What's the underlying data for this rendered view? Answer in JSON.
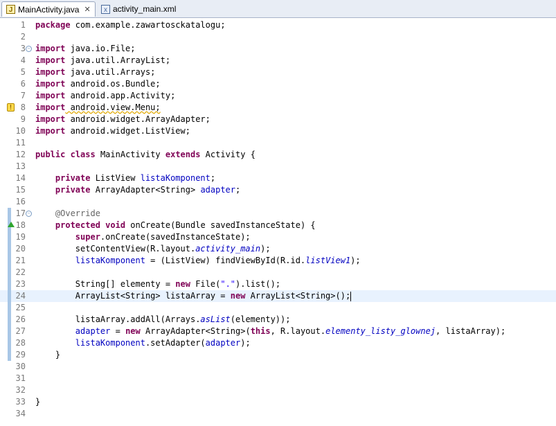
{
  "tabs": [
    {
      "label": "MainActivity.java",
      "icon": "java-file-icon",
      "active": true,
      "close": "✕"
    },
    {
      "label": "activity_main.xml",
      "icon": "xml-file-icon",
      "active": false
    }
  ],
  "current_line": 24,
  "lines": [
    {
      "n": "1",
      "t": [
        [
          "kw",
          "package"
        ],
        [
          "",
          "com.example.zawartosckatalogu;"
        ]
      ]
    },
    {
      "n": "2",
      "t": []
    },
    {
      "n": "3",
      "fold": "−",
      "t": [
        [
          "kw",
          "import"
        ],
        [
          "",
          "java.io.File;"
        ]
      ]
    },
    {
      "n": "4",
      "t": [
        [
          "kw",
          "import"
        ],
        [
          "",
          "java.util.ArrayList;"
        ]
      ]
    },
    {
      "n": "5",
      "t": [
        [
          "kw",
          "import"
        ],
        [
          "",
          "java.util.Arrays;"
        ]
      ]
    },
    {
      "n": "6",
      "t": [
        [
          "kw",
          "import"
        ],
        [
          "",
          "android.os.Bundle;"
        ]
      ]
    },
    {
      "n": "7",
      "t": [
        [
          "kw",
          "import"
        ],
        [
          "",
          "android.app.Activity;"
        ]
      ]
    },
    {
      "n": "8",
      "marker": "warning",
      "t": [
        [
          "kw",
          "import"
        ],
        [
          "",
          "android.view.Menu;",
          "warn"
        ]
      ]
    },
    {
      "n": "9",
      "t": [
        [
          "kw",
          "import"
        ],
        [
          "",
          "android.widget.ArrayAdapter;"
        ]
      ]
    },
    {
      "n": "10",
      "t": [
        [
          "kw",
          "import"
        ],
        [
          "",
          "android.widget.ListView;"
        ]
      ]
    },
    {
      "n": "11",
      "t": []
    },
    {
      "n": "12",
      "t": [
        [
          "kw",
          "public"
        ],
        [
          "",
          " "
        ],
        [
          "kw",
          "class"
        ],
        [
          "",
          " MainActivity "
        ],
        [
          "kw",
          "extends"
        ],
        [
          "",
          " Activity {"
        ]
      ]
    },
    {
      "n": "13",
      "t": []
    },
    {
      "n": "14",
      "t": [
        [
          "",
          "    "
        ],
        [
          "kw",
          "private"
        ],
        [
          "",
          " ListView "
        ],
        [
          "fld",
          "listaKomponent"
        ],
        [
          "",
          ";"
        ]
      ]
    },
    {
      "n": "15",
      "t": [
        [
          "",
          "    "
        ],
        [
          "kw",
          "private"
        ],
        [
          "",
          " ArrayAdapter<String> "
        ],
        [
          "fld",
          "adapter"
        ],
        [
          "",
          ";"
        ]
      ]
    },
    {
      "n": "16",
      "t": []
    },
    {
      "n": "17",
      "fold": "−",
      "mark": true,
      "t": [
        [
          "",
          "    "
        ],
        [
          "ann",
          "@Override"
        ]
      ]
    },
    {
      "n": "18",
      "marker": "override",
      "mark": true,
      "t": [
        [
          "",
          "    "
        ],
        [
          "kw",
          "protected"
        ],
        [
          "",
          " "
        ],
        [
          "kw",
          "void"
        ],
        [
          "",
          " onCreate(Bundle savedInstanceState) {"
        ]
      ]
    },
    {
      "n": "19",
      "mark": true,
      "t": [
        [
          "",
          "        "
        ],
        [
          "kw",
          "super"
        ],
        [
          "",
          ".onCreate(savedInstanceState);"
        ]
      ]
    },
    {
      "n": "20",
      "mark": true,
      "t": [
        [
          "",
          "        setContentView(R.layout."
        ],
        [
          "sfld",
          "activity_main"
        ],
        [
          "",
          ");"
        ]
      ]
    },
    {
      "n": "21",
      "mark": true,
      "t": [
        [
          "",
          "        "
        ],
        [
          "fld",
          "listaKomponent"
        ],
        [
          "",
          " = (ListView) findViewById(R.id."
        ],
        [
          "sfld",
          "listView1"
        ],
        [
          "",
          ");"
        ]
      ]
    },
    {
      "n": "22",
      "mark": true,
      "t": []
    },
    {
      "n": "23",
      "mark": true,
      "t": [
        [
          "",
          "        String[] elementy = "
        ],
        [
          "kw",
          "new"
        ],
        [
          "",
          " File("
        ],
        [
          "str",
          "\".\""
        ],
        [
          "",
          ").list();"
        ]
      ]
    },
    {
      "n": "24",
      "mark": true,
      "t": [
        [
          "",
          "        ArrayList<String> listaArray = "
        ],
        [
          "kw",
          "new"
        ],
        [
          "",
          " ArrayList<String>();"
        ]
      ],
      "caret": true
    },
    {
      "n": "25",
      "mark": true,
      "t": []
    },
    {
      "n": "26",
      "mark": true,
      "t": [
        [
          "",
          "        listaArray.addAll(Arrays."
        ],
        [
          "sfld",
          "asList"
        ],
        [
          "",
          "(elementy));"
        ]
      ]
    },
    {
      "n": "27",
      "mark": true,
      "t": [
        [
          "",
          "        "
        ],
        [
          "fld",
          "adapter"
        ],
        [
          "",
          " = "
        ],
        [
          "kw",
          "new"
        ],
        [
          "",
          " ArrayAdapter<String>("
        ],
        [
          "kw",
          "this"
        ],
        [
          "",
          ", R.layout."
        ],
        [
          "sfld",
          "elementy_listy_glownej"
        ],
        [
          "",
          ", listaArray);"
        ]
      ]
    },
    {
      "n": "28",
      "mark": true,
      "t": [
        [
          "",
          "        "
        ],
        [
          "fld",
          "listaKomponent"
        ],
        [
          "",
          ".setAdapter("
        ],
        [
          "fld",
          "adapter"
        ],
        [
          "",
          ");"
        ]
      ]
    },
    {
      "n": "29",
      "mark": true,
      "t": [
        [
          "",
          "    }"
        ]
      ]
    },
    {
      "n": "30",
      "t": []
    },
    {
      "n": "31",
      "t": []
    },
    {
      "n": "32",
      "t": []
    },
    {
      "n": "33",
      "t": [
        [
          "",
          "}"
        ]
      ]
    },
    {
      "n": "34",
      "t": []
    }
  ]
}
